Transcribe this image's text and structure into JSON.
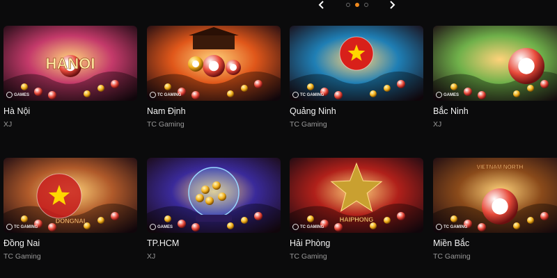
{
  "carousel": {
    "prev_icon": "chevron-left-icon",
    "next_icon": "chevron-right-icon",
    "pages": 3,
    "active_page": 2,
    "accent": "#f08a1e"
  },
  "games": [
    {
      "title": "Hà Nội",
      "provider": "XJ",
      "art_text": "HANOI",
      "theme": "#c43a6a",
      "badge": "GAMES"
    },
    {
      "title": "Nam Định",
      "provider": "TC Gaming",
      "art_text": "",
      "theme": "#e0571a",
      "badge": "TC GAMING"
    },
    {
      "title": "Quảng Ninh",
      "provider": "TC Gaming",
      "art_text": "",
      "theme": "#1f7fb5",
      "badge": "TC GAMING"
    },
    {
      "title": "Bắc Ninh",
      "provider": "XJ",
      "art_text": "",
      "theme": "#6fb04a",
      "badge": "GAMES"
    },
    {
      "title": "Đồng Nai",
      "provider": "TC Gaming",
      "art_text": "DONGNAI",
      "theme": "#b05a2a",
      "badge": "TC GAMING"
    },
    {
      "title": "TP.HCM",
      "provider": "XJ",
      "art_text": "",
      "theme": "#3a2a9a",
      "badge": "GAMES"
    },
    {
      "title": "Hải Phòng",
      "provider": "TC Gaming",
      "art_text": "HAIPHONG",
      "theme": "#b0201a",
      "badge": "TC GAMING"
    },
    {
      "title": "Miền Bắc",
      "provider": "TC Gaming",
      "art_text": "VIETNAM NORTH",
      "theme": "#8a4a1a",
      "badge": "TC GAMING"
    }
  ]
}
